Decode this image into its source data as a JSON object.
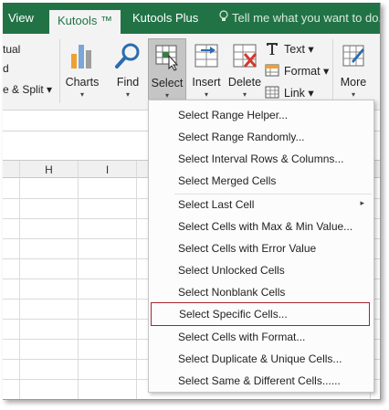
{
  "tabs": {
    "view": "View",
    "kutools": "Kutools ™",
    "kutools_plus": "Kutools Plus",
    "tell_me": "Tell me what you want to do..."
  },
  "ribbon": {
    "left_fragments": [
      "tual",
      "d",
      "e & Split ▾"
    ],
    "buttons": {
      "charts": "Charts",
      "find": "Find",
      "select": "Select",
      "insert": "Insert",
      "delete": "Delete",
      "more": "More"
    },
    "small_buttons": {
      "text": "Text ▾",
      "format": "Format ▾",
      "link": "Link ▾"
    },
    "dropdown_arrow": "▾"
  },
  "grid": {
    "columns": [
      "H",
      "I"
    ]
  },
  "menu": {
    "items": [
      "Select Range Helper...",
      "Select Range Randomly...",
      "Select Interval Rows & Columns...",
      "Select Merged Cells",
      "Select Last Cell",
      "Select Cells with Max & Min Value...",
      "Select Cells with Error Value",
      "Select Unlocked Cells",
      "Select Nonblank Cells",
      "Select Specific Cells...",
      "Select Cells with Format...",
      "Select Duplicate & Unique Cells...",
      "Select Same & Different Cells......"
    ],
    "submenu_arrow": "▸"
  },
  "colors": {
    "excel_green": "#217346",
    "ribbon_bg": "#f3f3f3",
    "highlight_border": "#a4262c",
    "icon_blue": "#2b6cb0"
  }
}
